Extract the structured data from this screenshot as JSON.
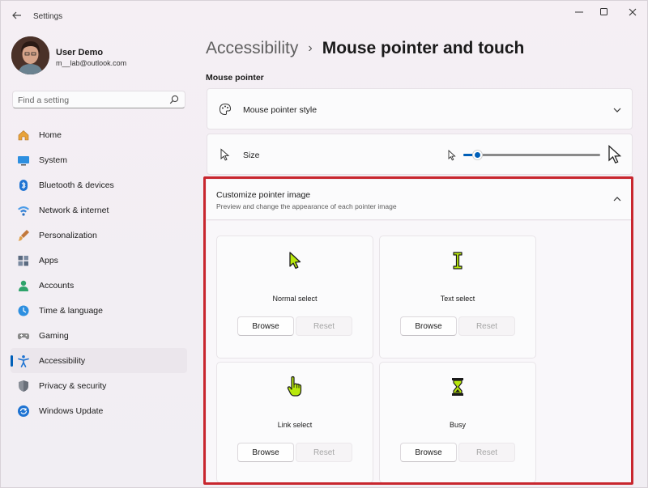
{
  "app": {
    "title": "Settings"
  },
  "user": {
    "name": "User Demo",
    "email": "m__lab@outlook.com"
  },
  "search": {
    "placeholder": "Find a setting"
  },
  "sidebar": {
    "items": [
      {
        "label": "Home",
        "icon": "home-icon",
        "active": false
      },
      {
        "label": "System",
        "icon": "system-icon",
        "active": false
      },
      {
        "label": "Bluetooth & devices",
        "icon": "bluetooth-icon",
        "active": false
      },
      {
        "label": "Network & internet",
        "icon": "wifi-icon",
        "active": false
      },
      {
        "label": "Personalization",
        "icon": "brush-icon",
        "active": false
      },
      {
        "label": "Apps",
        "icon": "apps-icon",
        "active": false
      },
      {
        "label": "Accounts",
        "icon": "person-icon",
        "active": false
      },
      {
        "label": "Time & language",
        "icon": "globe-clock-icon",
        "active": false
      },
      {
        "label": "Gaming",
        "icon": "gamepad-icon",
        "active": false
      },
      {
        "label": "Accessibility",
        "icon": "accessibility-icon",
        "active": true
      },
      {
        "label": "Privacy & security",
        "icon": "shield-icon",
        "active": false
      },
      {
        "label": "Windows Update",
        "icon": "update-icon",
        "active": false
      }
    ]
  },
  "breadcrumb": {
    "parent": "Accessibility",
    "separator": "›",
    "current": "Mouse pointer and touch"
  },
  "main": {
    "section_title": "Mouse pointer",
    "pointer_style": {
      "label": "Mouse pointer style"
    },
    "size": {
      "label": "Size",
      "slider_value": 0.1
    },
    "customize": {
      "title": "Customize pointer image",
      "subtitle": "Preview and change the appearance of each pointer image",
      "tiles": [
        {
          "label": "Normal select",
          "browse": "Browse",
          "reset": "Reset",
          "icon": "arrow-cursor-icon"
        },
        {
          "label": "Text select",
          "browse": "Browse",
          "reset": "Reset",
          "icon": "ibeam-cursor-icon"
        },
        {
          "label": "Link select",
          "browse": "Browse",
          "reset": "Reset",
          "icon": "hand-cursor-icon"
        },
        {
          "label": "Busy",
          "browse": "Browse",
          "reset": "Reset",
          "icon": "hourglass-cursor-icon"
        }
      ]
    }
  },
  "colors": {
    "accent": "#005fb8",
    "highlight": "#c8262e",
    "pointer_fill": "#b8e80c"
  }
}
